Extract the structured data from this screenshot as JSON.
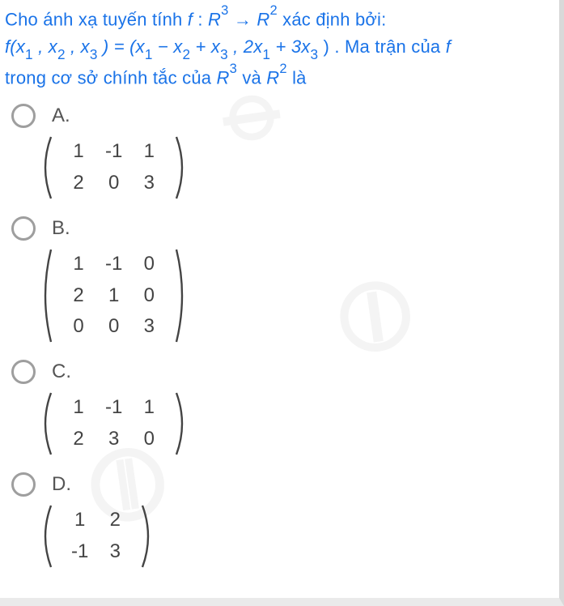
{
  "question": {
    "line1_pre": "Cho  ánh  xạ  tuyến  tính  ",
    "f": "f",
    "colon": " :  ",
    "R": "R",
    "arrow": " → ",
    "line1_post": "  xác  định  bởi:",
    "fx": "f(x",
    "s1": "1",
    "comma": ", x",
    "s2": "2",
    "s3": "3",
    "eq_open": ") = (x",
    "minus": " − x",
    "plus1": " + x",
    "sep": ", 2x",
    "plus2": " + 3x",
    "close": ") .",
    "line2_post": " Ma trận của ",
    "line3_pre": "trong cơ sở chính tắc của ",
    "and": " và ",
    "is": " là"
  },
  "options": [
    {
      "label": "A.",
      "rows": [
        [
          "1",
          "-1",
          "1"
        ],
        [
          "2",
          "0",
          "3"
        ]
      ]
    },
    {
      "label": "B.",
      "rows": [
        [
          "1",
          "-1",
          "0"
        ],
        [
          "2",
          "1",
          "0"
        ],
        [
          "0",
          "0",
          "3"
        ]
      ]
    },
    {
      "label": "C.",
      "rows": [
        [
          "1",
          "-1",
          "1"
        ],
        [
          "2",
          "3",
          "0"
        ]
      ]
    },
    {
      "label": "D.",
      "rows": [
        [
          "1",
          "2"
        ],
        [
          "-1",
          "3"
        ]
      ]
    }
  ]
}
